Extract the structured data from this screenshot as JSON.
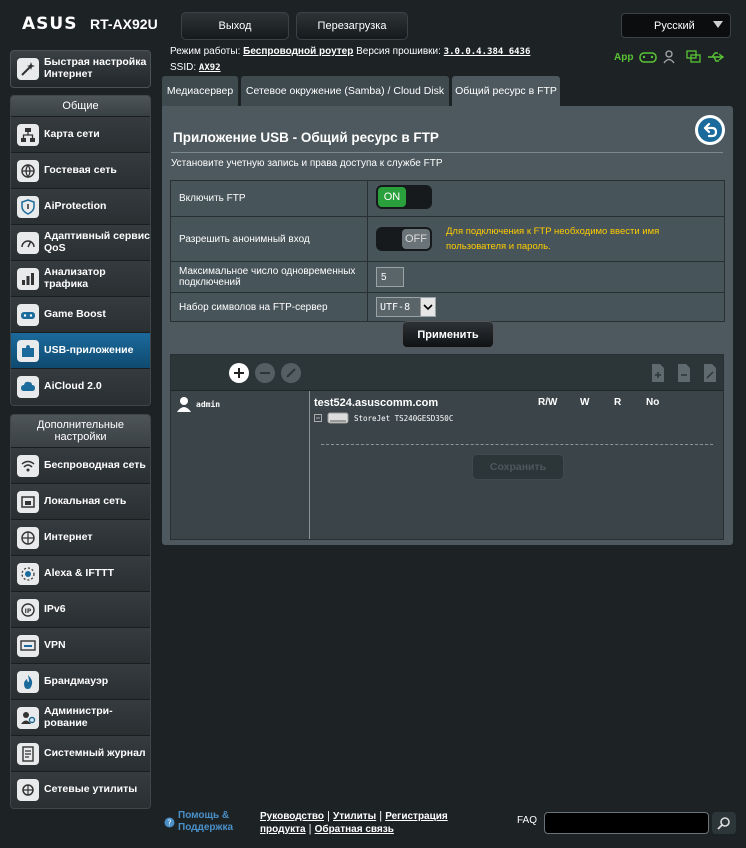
{
  "header": {
    "brand": "ASUS",
    "model": "RT-AX92U",
    "logout_label": "Выход",
    "reboot_label": "Перезагрузка",
    "language": "Русский"
  },
  "status": {
    "mode_label": "Режим работы:",
    "mode_value": "Беспроводной роутер",
    "firmware_label": "Версия прошивки:",
    "firmware_value": "3.0.0.4.384_6436",
    "ssid_label": "SSID:",
    "ssid_value": "AX92",
    "app_label": "App"
  },
  "sidebar": {
    "qis_label": "Быстрая настройка Интернет",
    "general_header": "Общие",
    "general_items": [
      {
        "label": "Карта сети"
      },
      {
        "label": "Гостевая сеть"
      },
      {
        "label": "AiProtection"
      },
      {
        "label": "Адаптивный сервис QoS"
      },
      {
        "label": "Анализатор трафика"
      },
      {
        "label": "Game Boost"
      },
      {
        "label": "USB-приложение"
      },
      {
        "label": "AiCloud 2.0"
      }
    ],
    "advanced_header": "Дополнительные настройки",
    "advanced_items": [
      {
        "label": "Беспроводная сеть"
      },
      {
        "label": "Локальная сеть"
      },
      {
        "label": "Интернет"
      },
      {
        "label": "Alexa & IFTTT"
      },
      {
        "label": "IPv6"
      },
      {
        "label": "VPN"
      },
      {
        "label": "Брандмауэр"
      },
      {
        "label": "Администри-рование"
      },
      {
        "label": "Системный журнал"
      },
      {
        "label": "Сетевые утилиты"
      }
    ]
  },
  "tabs": [
    {
      "label": "Медиасервер"
    },
    {
      "label": "Сетевое окружение (Samba) / Cloud Disk"
    },
    {
      "label": "Общий ресурс в FTP"
    }
  ],
  "main": {
    "title": "Приложение USB - Общий ресурс в FTP",
    "subtitle": "Установите учетную запись и права доступа к службе FTP",
    "rows": [
      {
        "label": "Включить FTP",
        "toggle": "ON"
      },
      {
        "label": "Разрешить анонимный вход",
        "toggle": "OFF",
        "hint": "Для подключения к FTP необходимо ввести имя пользователя и пароль."
      },
      {
        "label": "Максимальное число одновременных подключений",
        "value": "5"
      },
      {
        "label": "Набор символов на FTP-сервер",
        "value": "UTF-8"
      }
    ],
    "apply_label": "Применить"
  },
  "ftp": {
    "user": "admin",
    "domain": "test524.asuscomm.com",
    "perm_headers": [
      "R/W",
      "W",
      "R",
      "No"
    ],
    "disk": "StoreJet TS240GESD350C",
    "save_label": "Сохранить"
  },
  "footer": {
    "help": "Помощь & Поддержка",
    "links": [
      "Руководство",
      "Утилиты",
      "Регистрация продукта",
      "Обратная связь"
    ],
    "faq": "FAQ"
  }
}
